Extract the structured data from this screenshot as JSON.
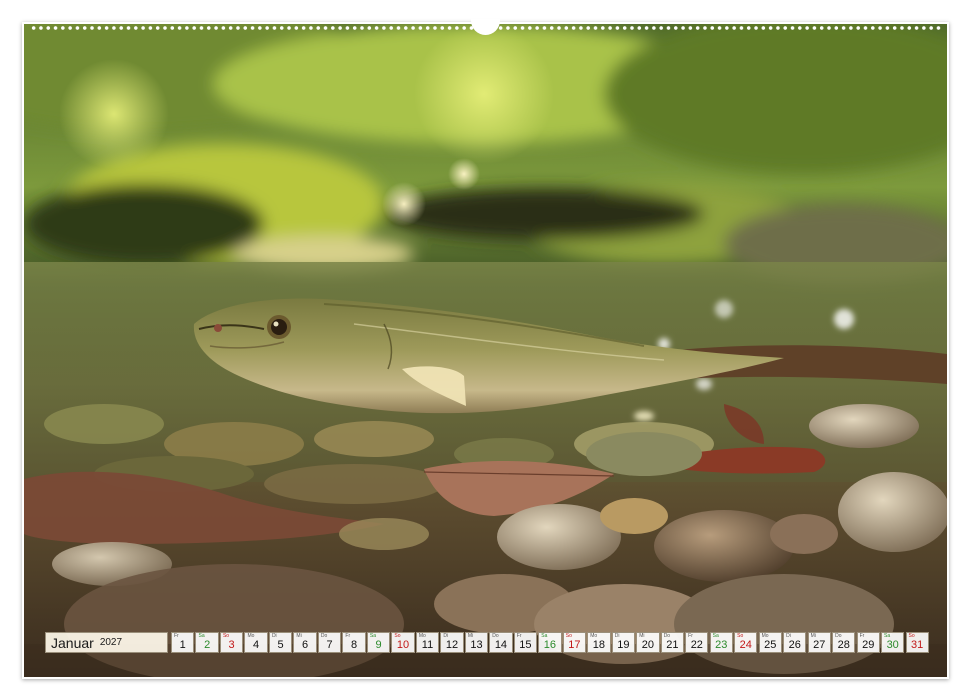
{
  "calendar": {
    "month": "Januar",
    "year": "2027",
    "days": [
      {
        "n": "1",
        "w": "Fr",
        "t": "wk"
      },
      {
        "n": "2",
        "w": "Sa",
        "t": "sat"
      },
      {
        "n": "3",
        "w": "So",
        "t": "sun"
      },
      {
        "n": "4",
        "w": "Mo",
        "t": "wk"
      },
      {
        "n": "5",
        "w": "Di",
        "t": "wk"
      },
      {
        "n": "6",
        "w": "Mi",
        "t": "wk"
      },
      {
        "n": "7",
        "w": "Do",
        "t": "wk"
      },
      {
        "n": "8",
        "w": "Fr",
        "t": "wk"
      },
      {
        "n": "9",
        "w": "Sa",
        "t": "sat"
      },
      {
        "n": "10",
        "w": "So",
        "t": "sun"
      },
      {
        "n": "11",
        "w": "Mo",
        "t": "wk"
      },
      {
        "n": "12",
        "w": "Di",
        "t": "wk"
      },
      {
        "n": "13",
        "w": "Mi",
        "t": "wk"
      },
      {
        "n": "14",
        "w": "Do",
        "t": "wk"
      },
      {
        "n": "15",
        "w": "Fr",
        "t": "wk"
      },
      {
        "n": "16",
        "w": "Sa",
        "t": "sat"
      },
      {
        "n": "17",
        "w": "So",
        "t": "sun"
      },
      {
        "n": "18",
        "w": "Mo",
        "t": "wk"
      },
      {
        "n": "19",
        "w": "Di",
        "t": "wk"
      },
      {
        "n": "20",
        "w": "Mi",
        "t": "wk"
      },
      {
        "n": "21",
        "w": "Do",
        "t": "wk"
      },
      {
        "n": "22",
        "w": "Fr",
        "t": "wk"
      },
      {
        "n": "23",
        "w": "Sa",
        "t": "sat"
      },
      {
        "n": "24",
        "w": "So",
        "t": "sun"
      },
      {
        "n": "25",
        "w": "Mo",
        "t": "wk"
      },
      {
        "n": "26",
        "w": "Di",
        "t": "wk"
      },
      {
        "n": "27",
        "w": "Mi",
        "t": "wk"
      },
      {
        "n": "28",
        "w": "Do",
        "t": "wk"
      },
      {
        "n": "29",
        "w": "Fr",
        "t": "wk"
      },
      {
        "n": "30",
        "w": "Sa",
        "t": "sat"
      },
      {
        "n": "31",
        "w": "So",
        "t": "sun"
      }
    ]
  },
  "colors": {
    "saturday": "#2b8a2b",
    "sunday": "#c21818"
  }
}
